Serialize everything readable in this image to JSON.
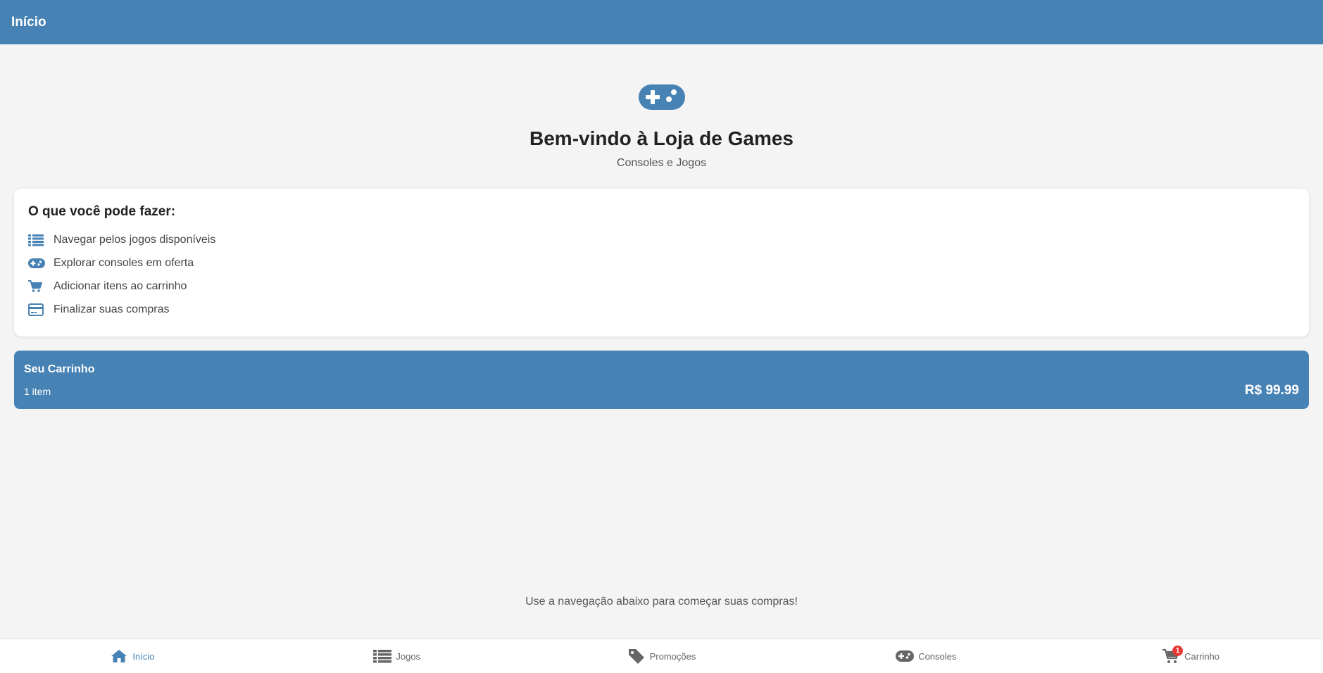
{
  "header": {
    "title": "Início"
  },
  "hero": {
    "icon": "gamepad-icon",
    "title": "Bem-vindo à Loja de Games",
    "subtitle": "Consoles e Jogos"
  },
  "features": {
    "heading": "O que você pode fazer:",
    "items": [
      {
        "icon": "list-icon",
        "label": "Navegar pelos jogos disponíveis"
      },
      {
        "icon": "gamepad-icon",
        "label": "Explorar consoles em oferta"
      },
      {
        "icon": "cart-icon",
        "label": "Adicionar itens ao carrinho"
      },
      {
        "icon": "credit-card-icon",
        "label": "Finalizar suas compras"
      }
    ]
  },
  "cart": {
    "title": "Seu Carrinho",
    "items_text": "1 item",
    "total": "R$ 99.99"
  },
  "hint": "Use a navegação abaixo para começar suas compras!",
  "nav": {
    "items": [
      {
        "icon": "home-icon",
        "label": "Início",
        "active": true
      },
      {
        "icon": "list-icon",
        "label": "Jogos",
        "active": false
      },
      {
        "icon": "tag-icon",
        "label": "Promoções",
        "active": false
      },
      {
        "icon": "gamepad-icon",
        "label": "Consoles",
        "active": false
      },
      {
        "icon": "cart-icon",
        "label": "Carrinho",
        "active": false,
        "badge": "1"
      }
    ]
  },
  "colors": {
    "primary": "#4682b4",
    "background": "#f4f4f4",
    "badge": "#e53935",
    "nav_inactive": "#666666"
  }
}
